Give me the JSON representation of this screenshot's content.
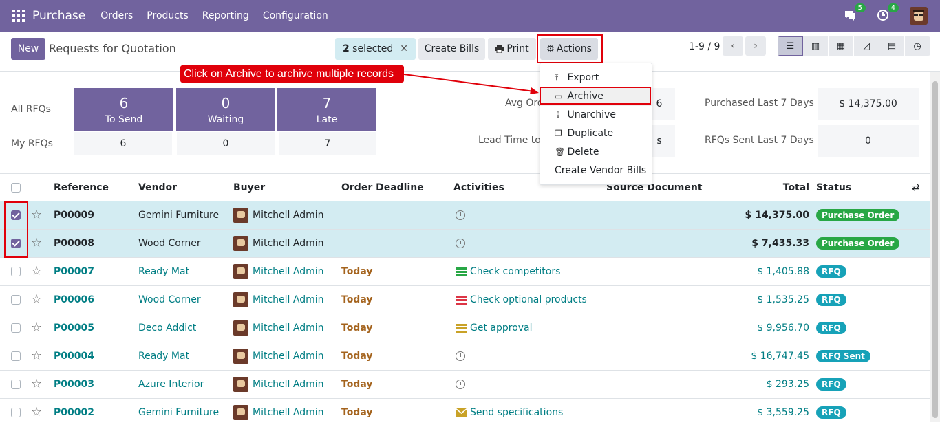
{
  "nav": {
    "app": "Purchase",
    "menus": [
      "Orders",
      "Products",
      "Reporting",
      "Configuration"
    ],
    "messages_count": "5",
    "activities_count": "4"
  },
  "control": {
    "new_label": "New",
    "title": "Requests for Quotation",
    "selected_count": "2",
    "selected_label": "selected",
    "create_bills": "Create Bills",
    "print": "Print",
    "actions": "Actions",
    "pager": "1-9 / 9"
  },
  "callout": "Click on Archive to archive multiple records",
  "dropdown": {
    "items": [
      "Export",
      "Archive",
      "Unarchive",
      "Duplicate",
      "Delete",
      "Create Vendor Bills"
    ]
  },
  "dashboard": {
    "all_label": "All RFQs",
    "my_label": "My RFQs",
    "tiles": [
      {
        "count": "6",
        "label": "To Send",
        "mine": "6"
      },
      {
        "count": "0",
        "label": "Waiting",
        "mine": "0"
      },
      {
        "count": "7",
        "label": "Late",
        "mine": "7"
      }
    ],
    "stats": [
      {
        "label": "Avg Ord",
        "value": "6"
      },
      {
        "label": "Lead Time to P",
        "value": "s"
      },
      {
        "label": "Purchased Last 7 Days",
        "value": "$ 14,375.00"
      },
      {
        "label": "RFQs Sent Last 7 Days",
        "value": "0"
      }
    ]
  },
  "table": {
    "headers": [
      "Reference",
      "Vendor",
      "Buyer",
      "Order Deadline",
      "Activities",
      "Source Document",
      "Total",
      "Status"
    ],
    "rows": [
      {
        "ref": "P00009",
        "vendor": "Gemini Furniture",
        "buyer": "Mitchell Admin",
        "deadline": "",
        "activity": "",
        "activity_icon": "clock-icon",
        "total": "$ 14,375.00",
        "status": "Purchase Order",
        "selected": true
      },
      {
        "ref": "P00008",
        "vendor": "Wood Corner",
        "buyer": "Mitchell Admin",
        "deadline": "",
        "activity": "",
        "activity_icon": "clock-icon",
        "total": "$ 7,435.33",
        "status": "Purchase Order",
        "selected": true
      },
      {
        "ref": "P00007",
        "vendor": "Ready Mat",
        "buyer": "Mitchell Admin",
        "deadline": "Today",
        "activity": "Check competitors",
        "activity_icon": "todo-green-icon",
        "total": "$ 1,405.88",
        "status": "RFQ",
        "selected": false
      },
      {
        "ref": "P00006",
        "vendor": "Wood Corner",
        "buyer": "Mitchell Admin",
        "deadline": "Today",
        "activity": "Check optional products",
        "activity_icon": "todo-red-icon",
        "total": "$ 1,535.25",
        "status": "RFQ",
        "selected": false
      },
      {
        "ref": "P00005",
        "vendor": "Deco Addict",
        "buyer": "Mitchell Admin",
        "deadline": "Today",
        "activity": "Get approval",
        "activity_icon": "todo-orange-icon",
        "total": "$ 9,956.70",
        "status": "RFQ",
        "selected": false
      },
      {
        "ref": "P00004",
        "vendor": "Ready Mat",
        "buyer": "Mitchell Admin",
        "deadline": "Today",
        "activity": "",
        "activity_icon": "clock-icon",
        "total": "$ 16,747.45",
        "status": "RFQ Sent",
        "selected": false
      },
      {
        "ref": "P00003",
        "vendor": "Azure Interior",
        "buyer": "Mitchell Admin",
        "deadline": "Today",
        "activity": "",
        "activity_icon": "clock-icon",
        "total": "$ 293.25",
        "status": "RFQ",
        "selected": false
      },
      {
        "ref": "P00002",
        "vendor": "Gemini Furniture",
        "buyer": "Mitchell Admin",
        "deadline": "Today",
        "activity": "Send specifications",
        "activity_icon": "envelope-icon",
        "total": "$ 3,559.25",
        "status": "RFQ",
        "selected": false
      }
    ]
  },
  "colors": {
    "brand": "#71639e",
    "selected_row": "#d3ecf2",
    "callout": "#e0000a",
    "link": "#017e84"
  }
}
